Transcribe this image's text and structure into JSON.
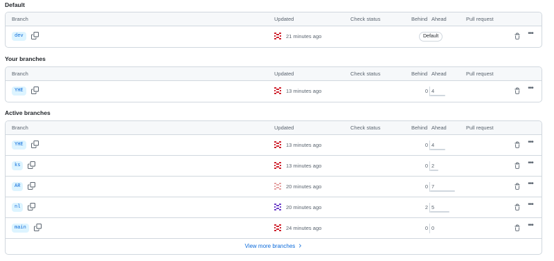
{
  "headers": {
    "branch": "Branch",
    "updated": "Updated",
    "check_status": "Check status",
    "behind": "Behind",
    "ahead": "Ahead",
    "pull_request": "Pull request"
  },
  "sections": {
    "default": {
      "title": "Default",
      "rows": [
        {
          "branch": "dev",
          "updated": "21 minutes ago",
          "badge": "Default",
          "avatar_color": "#cf222e"
        }
      ]
    },
    "yours": {
      "title": "Your branches",
      "rows": [
        {
          "branch": "YHE",
          "updated": "13 minutes ago",
          "behind": "0",
          "ahead": "4",
          "ahead_fraction": 0.55,
          "avatar_color": "#cf222e"
        }
      ]
    },
    "active": {
      "title": "Active branches",
      "rows": [
        {
          "branch": "YHE",
          "updated": "13 minutes ago",
          "behind": "0",
          "ahead": "4",
          "ahead_fraction": 0.55,
          "avatar_color": "#cf222e"
        },
        {
          "branch": "ks",
          "updated": "13 minutes ago",
          "behind": "0",
          "ahead": "2",
          "ahead_fraction": 0.3,
          "avatar_color": "#cf222e"
        },
        {
          "branch": "AR",
          "updated": "20 minutes ago",
          "behind": "0",
          "ahead": "7",
          "ahead_fraction": 0.9,
          "avatar_color": "#e5a3a3"
        },
        {
          "branch": "nl",
          "updated": "20 minutes ago",
          "behind": "2",
          "ahead": "5",
          "ahead_fraction": 0.7,
          "avatar_color": "#6e40c9"
        },
        {
          "branch": "main",
          "updated": "24 minutes ago",
          "behind": "0",
          "ahead": "0",
          "ahead_fraction": 0,
          "avatar_color": "#cf222e"
        }
      ],
      "view_more": "View more branches"
    }
  }
}
